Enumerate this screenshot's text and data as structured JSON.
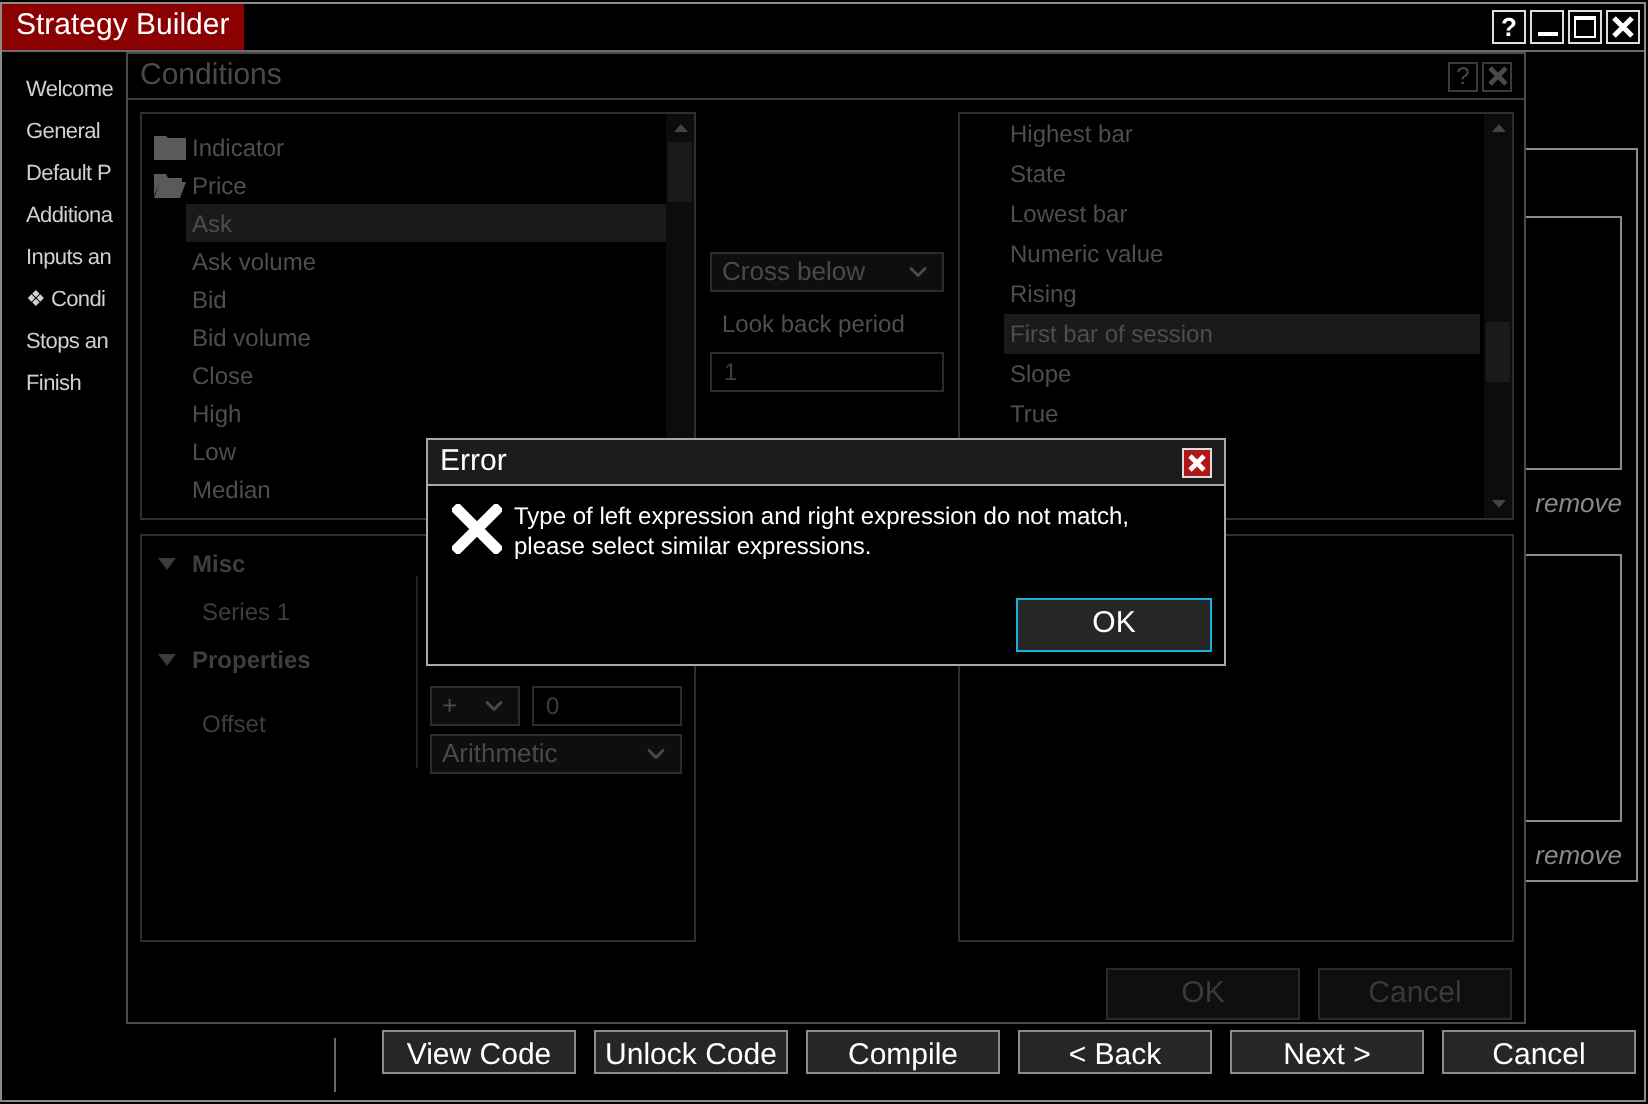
{
  "main_window": {
    "title": "Strategy Builder",
    "help_button": "?",
    "sidebar": [
      "Welcome",
      "General",
      "Default P",
      "Additiona",
      "Inputs an",
      "❖ Condi",
      "Stops an",
      "Finish"
    ],
    "remove_links": [
      "remove",
      "remove"
    ],
    "buttons": [
      "View Code",
      "Unlock Code",
      "Compile",
      "< Back",
      "Next >",
      "Cancel"
    ]
  },
  "conditions_dialog": {
    "title": "Conditions",
    "help_button": "?",
    "left_tree": [
      {
        "label": "Indicator",
        "expanded": false
      },
      {
        "label": "Price",
        "expanded": true,
        "children": [
          {
            "label": "Ask",
            "selected": true
          },
          {
            "label": "Ask volume",
            "selected": false
          },
          {
            "label": "Bid",
            "selected": false
          },
          {
            "label": "Bid volume",
            "selected": false
          },
          {
            "label": "Close",
            "selected": false
          },
          {
            "label": "High",
            "selected": false
          },
          {
            "label": "Low",
            "selected": false
          },
          {
            "label": "Median",
            "selected": false
          }
        ]
      }
    ],
    "properties": [
      {
        "label": "Misc",
        "expanded": true,
        "rows": [
          {
            "kind": "plain",
            "label": "Series 1"
          }
        ]
      },
      {
        "label": "Properties",
        "expanded": true,
        "rows": [
          {
            "kind": "offset",
            "label": "Offset",
            "operator": "+",
            "value": "0",
            "mode": "Arithmetic"
          }
        ]
      }
    ],
    "condition_select": "Cross below",
    "look_back": {
      "label": "Look back period",
      "value": "1"
    },
    "right_list": [
      {
        "label": "Highest bar",
        "selected": false
      },
      {
        "label": "State",
        "selected": false
      },
      {
        "label": "Lowest bar",
        "selected": false
      },
      {
        "label": "Numeric value",
        "selected": false
      },
      {
        "label": "Rising",
        "selected": false
      },
      {
        "label": "First bar of session",
        "selected": true
      },
      {
        "label": "Slope",
        "selected": false
      },
      {
        "label": "True",
        "selected": false
      }
    ],
    "buttons": [
      {
        "label": "OK",
        "disabled": true
      },
      {
        "label": "Cancel",
        "disabled": true
      }
    ]
  },
  "error_dialog": {
    "title": "Error",
    "message": "Type of left expression and right expression do not match, please select similar expressions.",
    "button": "OK"
  }
}
